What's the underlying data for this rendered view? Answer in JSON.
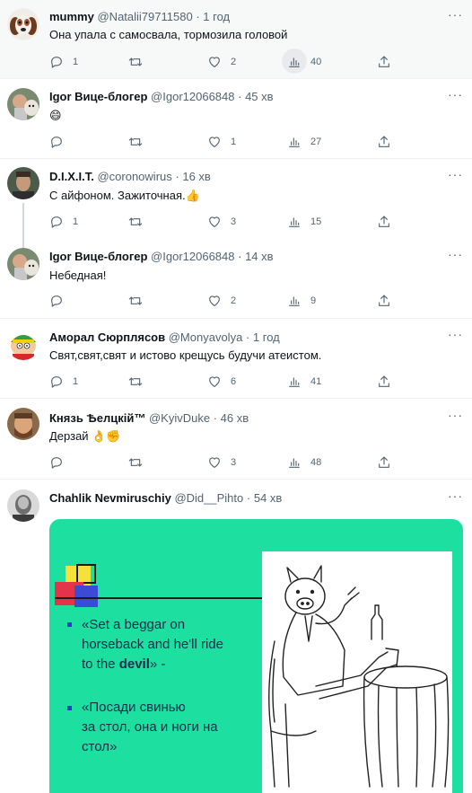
{
  "tweets": [
    {
      "name": "mummy",
      "handle": "@Natalii79711580",
      "sep": "·",
      "time": "1 год",
      "text": "Она упала с самосвала, тормозила головой",
      "replies": "1",
      "retweets": "",
      "likes": "2",
      "views": "40"
    },
    {
      "name": "Igor Вице-блогер",
      "handle": "@Igor12066848",
      "sep": "·",
      "time": "45 хв",
      "text": "😄",
      "replies": "",
      "retweets": "",
      "likes": "1",
      "views": "27"
    },
    {
      "name": "D.I.X.I.T.",
      "handle": "@coronowirus",
      "sep": "·",
      "time": "16 хв",
      "text": "С айфоном. Зажиточная.👍",
      "replies": "1",
      "retweets": "",
      "likes": "3",
      "views": "15"
    },
    {
      "name": "Igor Вице-блогер",
      "handle": "@Igor12066848",
      "sep": "·",
      "time": "14 хв",
      "text": "Небедная!",
      "replies": "",
      "retweets": "",
      "likes": "2",
      "views": "9"
    },
    {
      "name": "Аморал Сюрплясов",
      "handle": "@Monyavolya",
      "sep": "·",
      "time": "1 год",
      "text": "Свят,свят,свят и истово крещусь будучи атеистом.",
      "replies": "1",
      "retweets": "",
      "likes": "6",
      "views": "41"
    },
    {
      "name": "Князь Ѣелцкій™",
      "handle": "@KyivDuke",
      "sep": "·",
      "time": "46 хв",
      "text": "Дерзай 👌✊",
      "replies": "",
      "retweets": "",
      "likes": "3",
      "views": "48"
    },
    {
      "name": "Chahlik Nevmiruschiy",
      "handle": "@Did__Pihto",
      "sep": "·",
      "time": "54 хв"
    }
  ],
  "media": {
    "quote_en_1": "«Set a beggar on",
    "quote_en_2": "horseback and he'll ride",
    "quote_en_3a": "to the ",
    "quote_en_3b": "devil",
    "quote_en_3c": "» -",
    "quote_ru_1": "«Посади свинью",
    "quote_ru_2": "за стол, она и ноги на",
    "quote_ru_3": "стол»"
  },
  "more_glyph": "···",
  "colors": {
    "slide_bg": "#1ddf9f",
    "icon_gray": "#536471",
    "highlight_row": "#f7f9f9"
  }
}
